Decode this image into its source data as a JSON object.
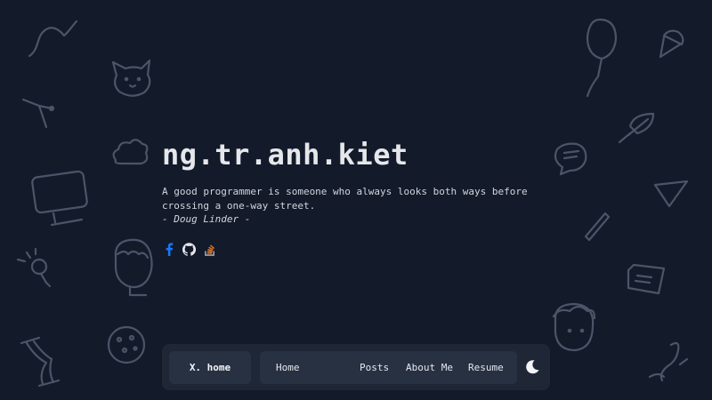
{
  "site": {
    "title": "ng.tr.anh.kiet",
    "quote": "A good programmer is someone who always looks both ways before crossing a one-way street.",
    "quote_author": "- Doug Linder -"
  },
  "socials": [
    {
      "icon": "facebook-icon",
      "color": "#1877f2"
    },
    {
      "icon": "github-icon",
      "color": "#e5e7eb"
    },
    {
      "icon": "stackoverflow-icon",
      "color": "#f48024"
    }
  ],
  "nav": {
    "brand": "X. home",
    "links": [
      "Home",
      "Posts",
      "About Me",
      "Resume"
    ],
    "theme_icon": "moon-icon"
  },
  "colors": {
    "background": "#131a2a",
    "navbar": "#1f2737",
    "nav_item": "#283142",
    "doodle": "#4b5568"
  }
}
